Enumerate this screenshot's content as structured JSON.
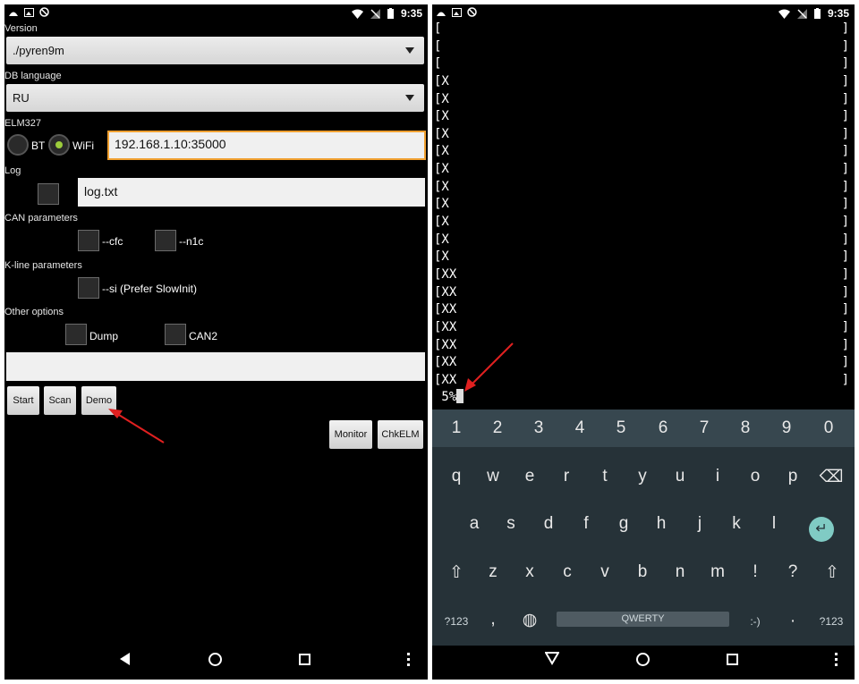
{
  "left": {
    "status_time": "9:35",
    "version": {
      "label": "Version",
      "value": "./pyren9m"
    },
    "db_language": {
      "label": "DB language",
      "value": "RU"
    },
    "elm327": {
      "label": "ELM327",
      "bt_label": "BT",
      "wifi_label": "WiFi",
      "address": "192.168.1.10:35000"
    },
    "log": {
      "label": "Log",
      "file": "log.txt"
    },
    "can": {
      "label": "CAN parameters",
      "cfc": "--cfc",
      "n1c": "--n1c"
    },
    "kline": {
      "label": "K-line parameters",
      "si": "--si (Prefer SlowInit)"
    },
    "other": {
      "label": "Other options",
      "dump": "Dump",
      "can2": "CAN2"
    },
    "buttons": {
      "start": "Start",
      "scan": "Scan",
      "demo": "Demo",
      "monitor": "Monitor",
      "chkelm": "ChkELM"
    }
  },
  "right": {
    "status_time": "9:35",
    "terminal_lines": [
      "[",
      "[",
      "[",
      "[X",
      "[X",
      "[X",
      "[X",
      "[X",
      "[X",
      "[X",
      "[X",
      "[X",
      "[X",
      "[X",
      "[XX",
      "[XX",
      "[XX",
      "[XX",
      "[XX",
      "[XX",
      "[XX"
    ],
    "prompt": "5%",
    "keyboard": {
      "numbers": [
        "1",
        "2",
        "3",
        "4",
        "5",
        "6",
        "7",
        "8",
        "9",
        "0"
      ],
      "row1": [
        "q",
        "w",
        "e",
        "r",
        "t",
        "y",
        "u",
        "i",
        "o",
        "p"
      ],
      "row2": [
        "a",
        "s",
        "d",
        "f",
        "g",
        "h",
        "j",
        "k",
        "l"
      ],
      "row3": [
        "z",
        "x",
        "c",
        "v",
        "b",
        "n",
        "m",
        "!",
        "?"
      ],
      "sym_left": "?123",
      "comma": ",",
      "space": "QWERTY",
      "emoticon": ":-)",
      "period": "·",
      "sym_right": "?123"
    }
  },
  "colors": {
    "accent_focus": "#f0a030",
    "radio_on": "#9ccc3c",
    "enter_key": "#80cbc4",
    "arrow": "#e02020"
  }
}
